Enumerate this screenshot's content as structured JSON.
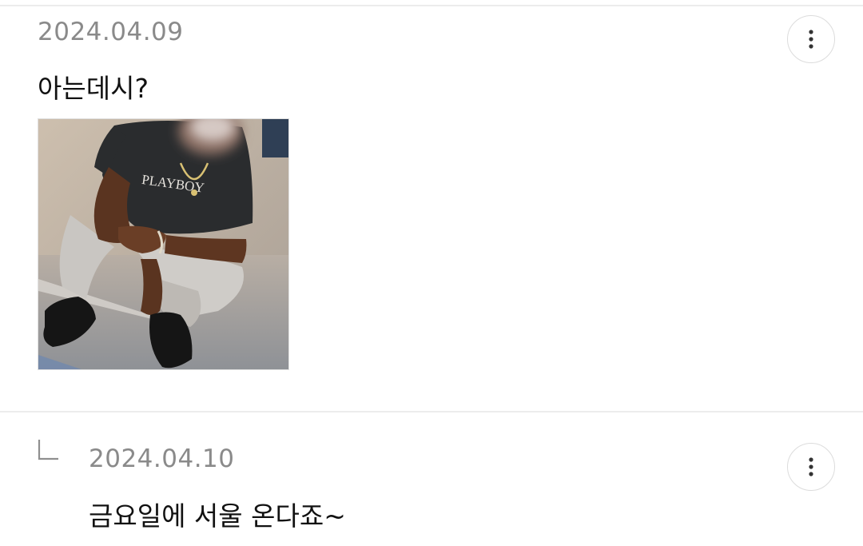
{
  "comments": [
    {
      "date": "2024.04.09",
      "text": "아는데시?",
      "image": {
        "shirt_text": "PLAYBOY"
      },
      "more_icon": "more-vertical-icon"
    },
    {
      "date": "2024.04.10",
      "text": "금요일에 서울 온다죠~",
      "reply_icon": "reply-arrow-icon",
      "more_icon": "more-vertical-icon"
    }
  ],
  "colors": {
    "date_text": "#8a8a8a",
    "body_text": "#111111",
    "divider": "#ececec",
    "button_border": "#dcdcdc"
  }
}
